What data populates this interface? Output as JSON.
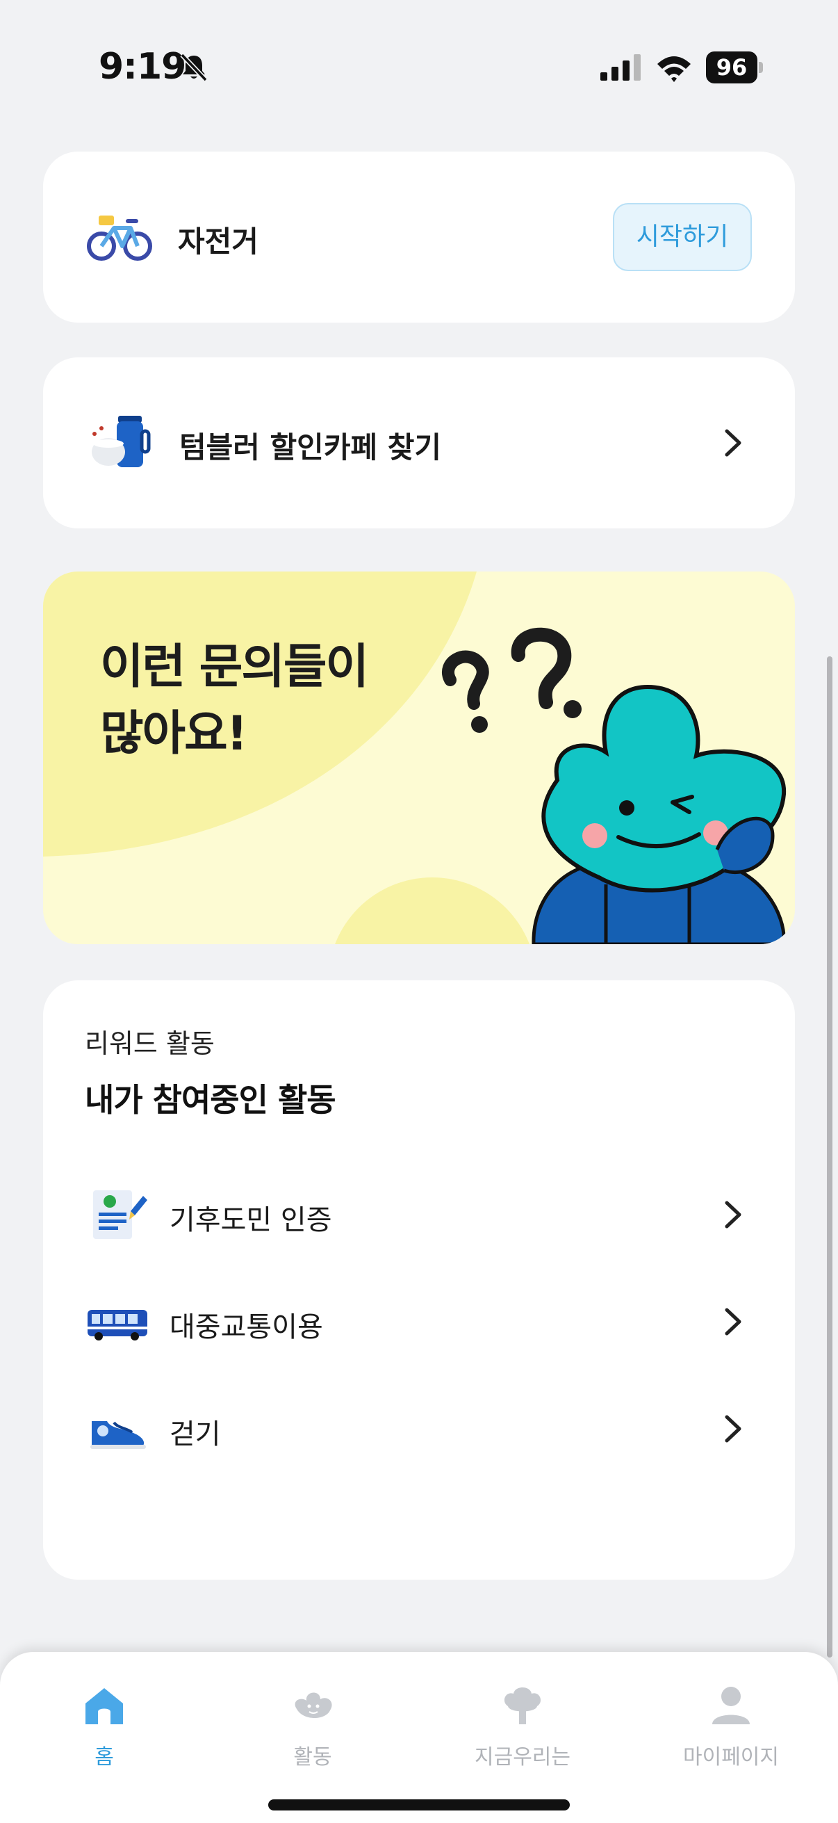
{
  "status_bar": {
    "time": "9:19",
    "battery": "96"
  },
  "bike_card": {
    "title": "자전거",
    "start_label": "시작하기"
  },
  "tumbler_card": {
    "title": "텀블러 할인카페 찾기"
  },
  "banner": {
    "title_line1": "이런 문의들이",
    "title_line2": "많아요!"
  },
  "activity": {
    "subtitle": "리워드 활동",
    "heading": "내가 참여중인 활동",
    "items": [
      {
        "label": "기후도민 인증",
        "icon": "certificate-icon"
      },
      {
        "label": "대중교통이용",
        "icon": "bus-icon"
      },
      {
        "label": "걷기",
        "icon": "shoe-icon"
      }
    ]
  },
  "tabbar": {
    "tabs": [
      {
        "label": "홈",
        "icon": "home-icon",
        "active": true
      },
      {
        "label": "활동",
        "icon": "character-icon",
        "active": false
      },
      {
        "label": "지금우리는",
        "icon": "tree-icon",
        "active": false
      },
      {
        "label": "마이페이지",
        "icon": "person-icon",
        "active": false
      }
    ]
  },
  "colors": {
    "accent": "#2e9bdb",
    "background": "#f1f2f4",
    "banner_bg": "#fdfbd3",
    "banner_blob": "#f8f3a5",
    "mascot": "#12c5c5"
  }
}
